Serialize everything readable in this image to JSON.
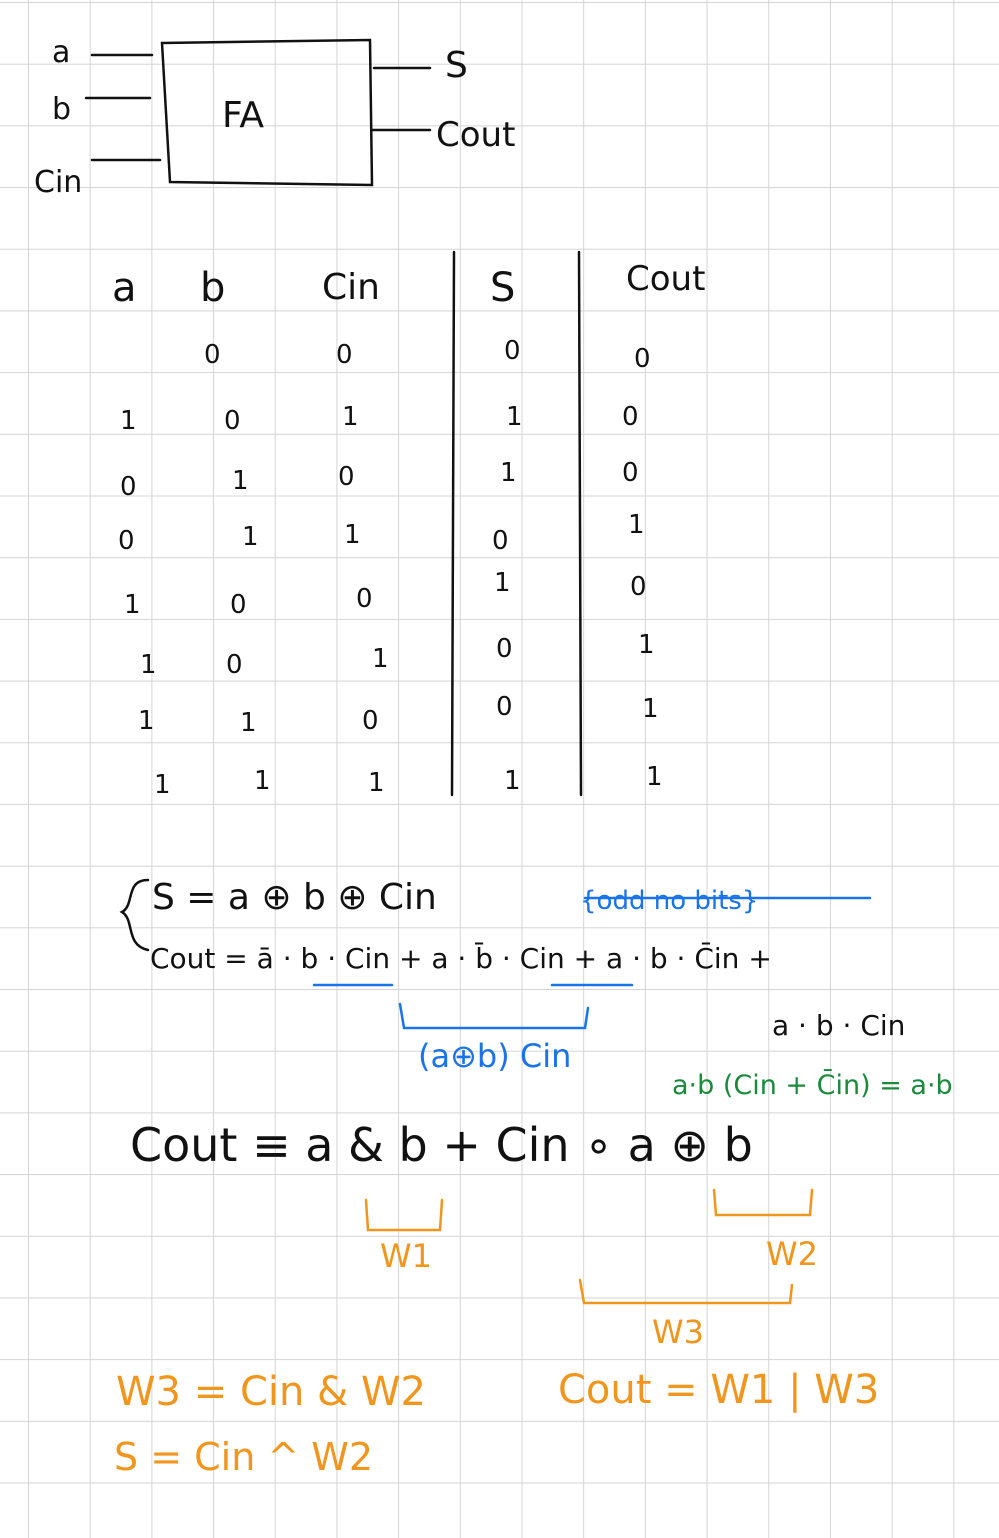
{
  "diagram": {
    "block_label": "FA",
    "inputs": [
      "a",
      "b",
      "Cin"
    ],
    "outputs": [
      "S",
      "Cout"
    ]
  },
  "truth_table": {
    "headers": [
      "a",
      "b",
      "Cin",
      "S",
      "Cout"
    ],
    "rows": [
      [
        "",
        "0",
        "0",
        "0",
        "0"
      ],
      [
        "1",
        "0",
        "1",
        "1",
        "0"
      ],
      [
        "0",
        "1",
        "0",
        "1",
        "0"
      ],
      [
        "0",
        "1",
        "1",
        "0",
        "1"
      ],
      [
        "1",
        "0",
        "0",
        "1",
        "0"
      ],
      [
        "1",
        "0",
        "1",
        "0",
        "1"
      ],
      [
        "1",
        "1",
        "0",
        "0",
        "1"
      ],
      [
        "1",
        "1",
        "1",
        "1",
        "1"
      ]
    ]
  },
  "equations": {
    "s_eq": "S  =  a ⊕ b ⊕ Cin",
    "odd_note": "{odd no bits}",
    "cout_eq": "Cout =  ā · b · Cin +  a · b̄ · Cin +  a · b · C̄in  +",
    "cout_cont": "a · b · Cin",
    "xor_note": "(a⊕b) Cin",
    "ab_note": "a·b (Cin + C̄in) = a·b",
    "cout_simplified": "Cout ≡  a & b + Cin  ∘  a ⊕ b",
    "w1": "W1",
    "w2": "W2",
    "w3": "W3",
    "w3_def": "W3 = Cin  & W2",
    "cout_final": "Cout = W1 | W3",
    "s_final": "S = Cin ^ W2"
  },
  "colors": {
    "ink": "#111111",
    "blue": "#1a73e8",
    "green": "#1b8a3a",
    "orange": "#f0961e",
    "grid": "#d4d4d4"
  }
}
